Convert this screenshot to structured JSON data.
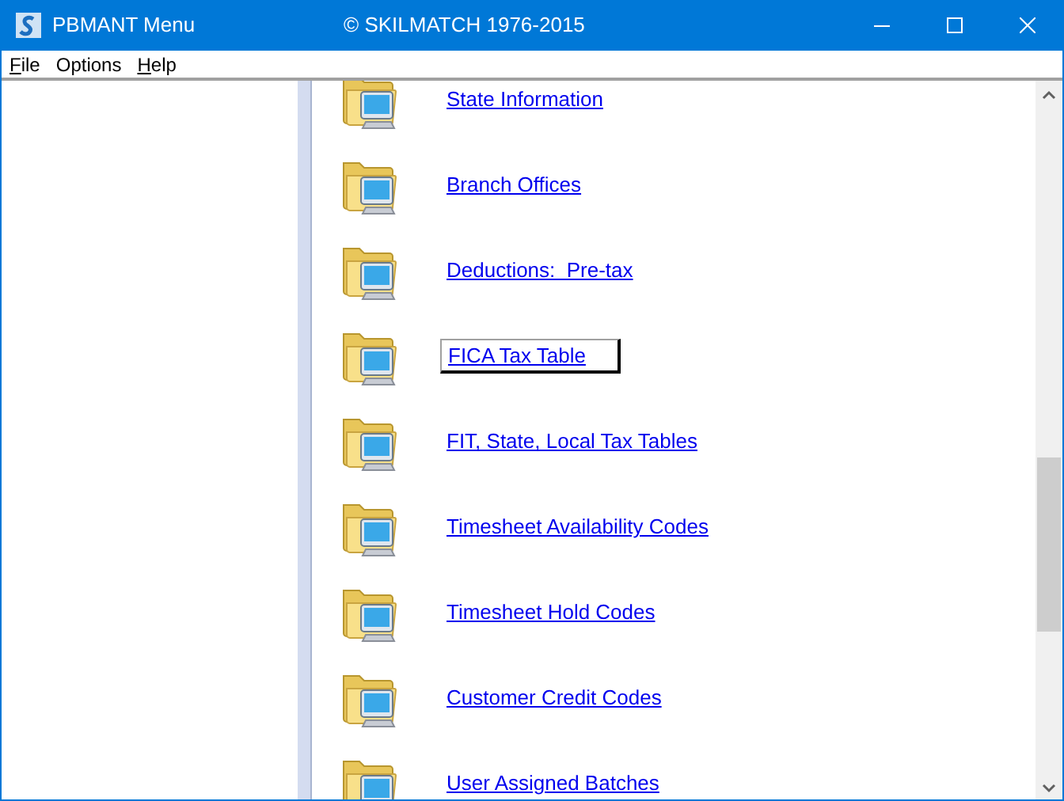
{
  "window": {
    "title": "PBMANT Menu",
    "subtitle": "© SKILMATCH 1976-2015"
  },
  "menu": [
    {
      "label": "File",
      "accelerator": true
    },
    {
      "label": "Options",
      "accelerator": false
    },
    {
      "label": "Help",
      "accelerator": true
    }
  ],
  "items": [
    {
      "label": "State Information",
      "selected": false
    },
    {
      "label": "Branch Offices",
      "selected": false
    },
    {
      "label": "Deductions:  Pre-tax",
      "selected": false
    },
    {
      "label": "FICA Tax Table",
      "selected": true
    },
    {
      "label": "FIT, State, Local Tax Tables",
      "selected": false
    },
    {
      "label": "Timesheet Availability Codes",
      "selected": false
    },
    {
      "label": "Timesheet Hold Codes",
      "selected": false
    },
    {
      "label": "Customer Credit Codes",
      "selected": false
    },
    {
      "label": "User Assigned Batches",
      "selected": false
    }
  ]
}
